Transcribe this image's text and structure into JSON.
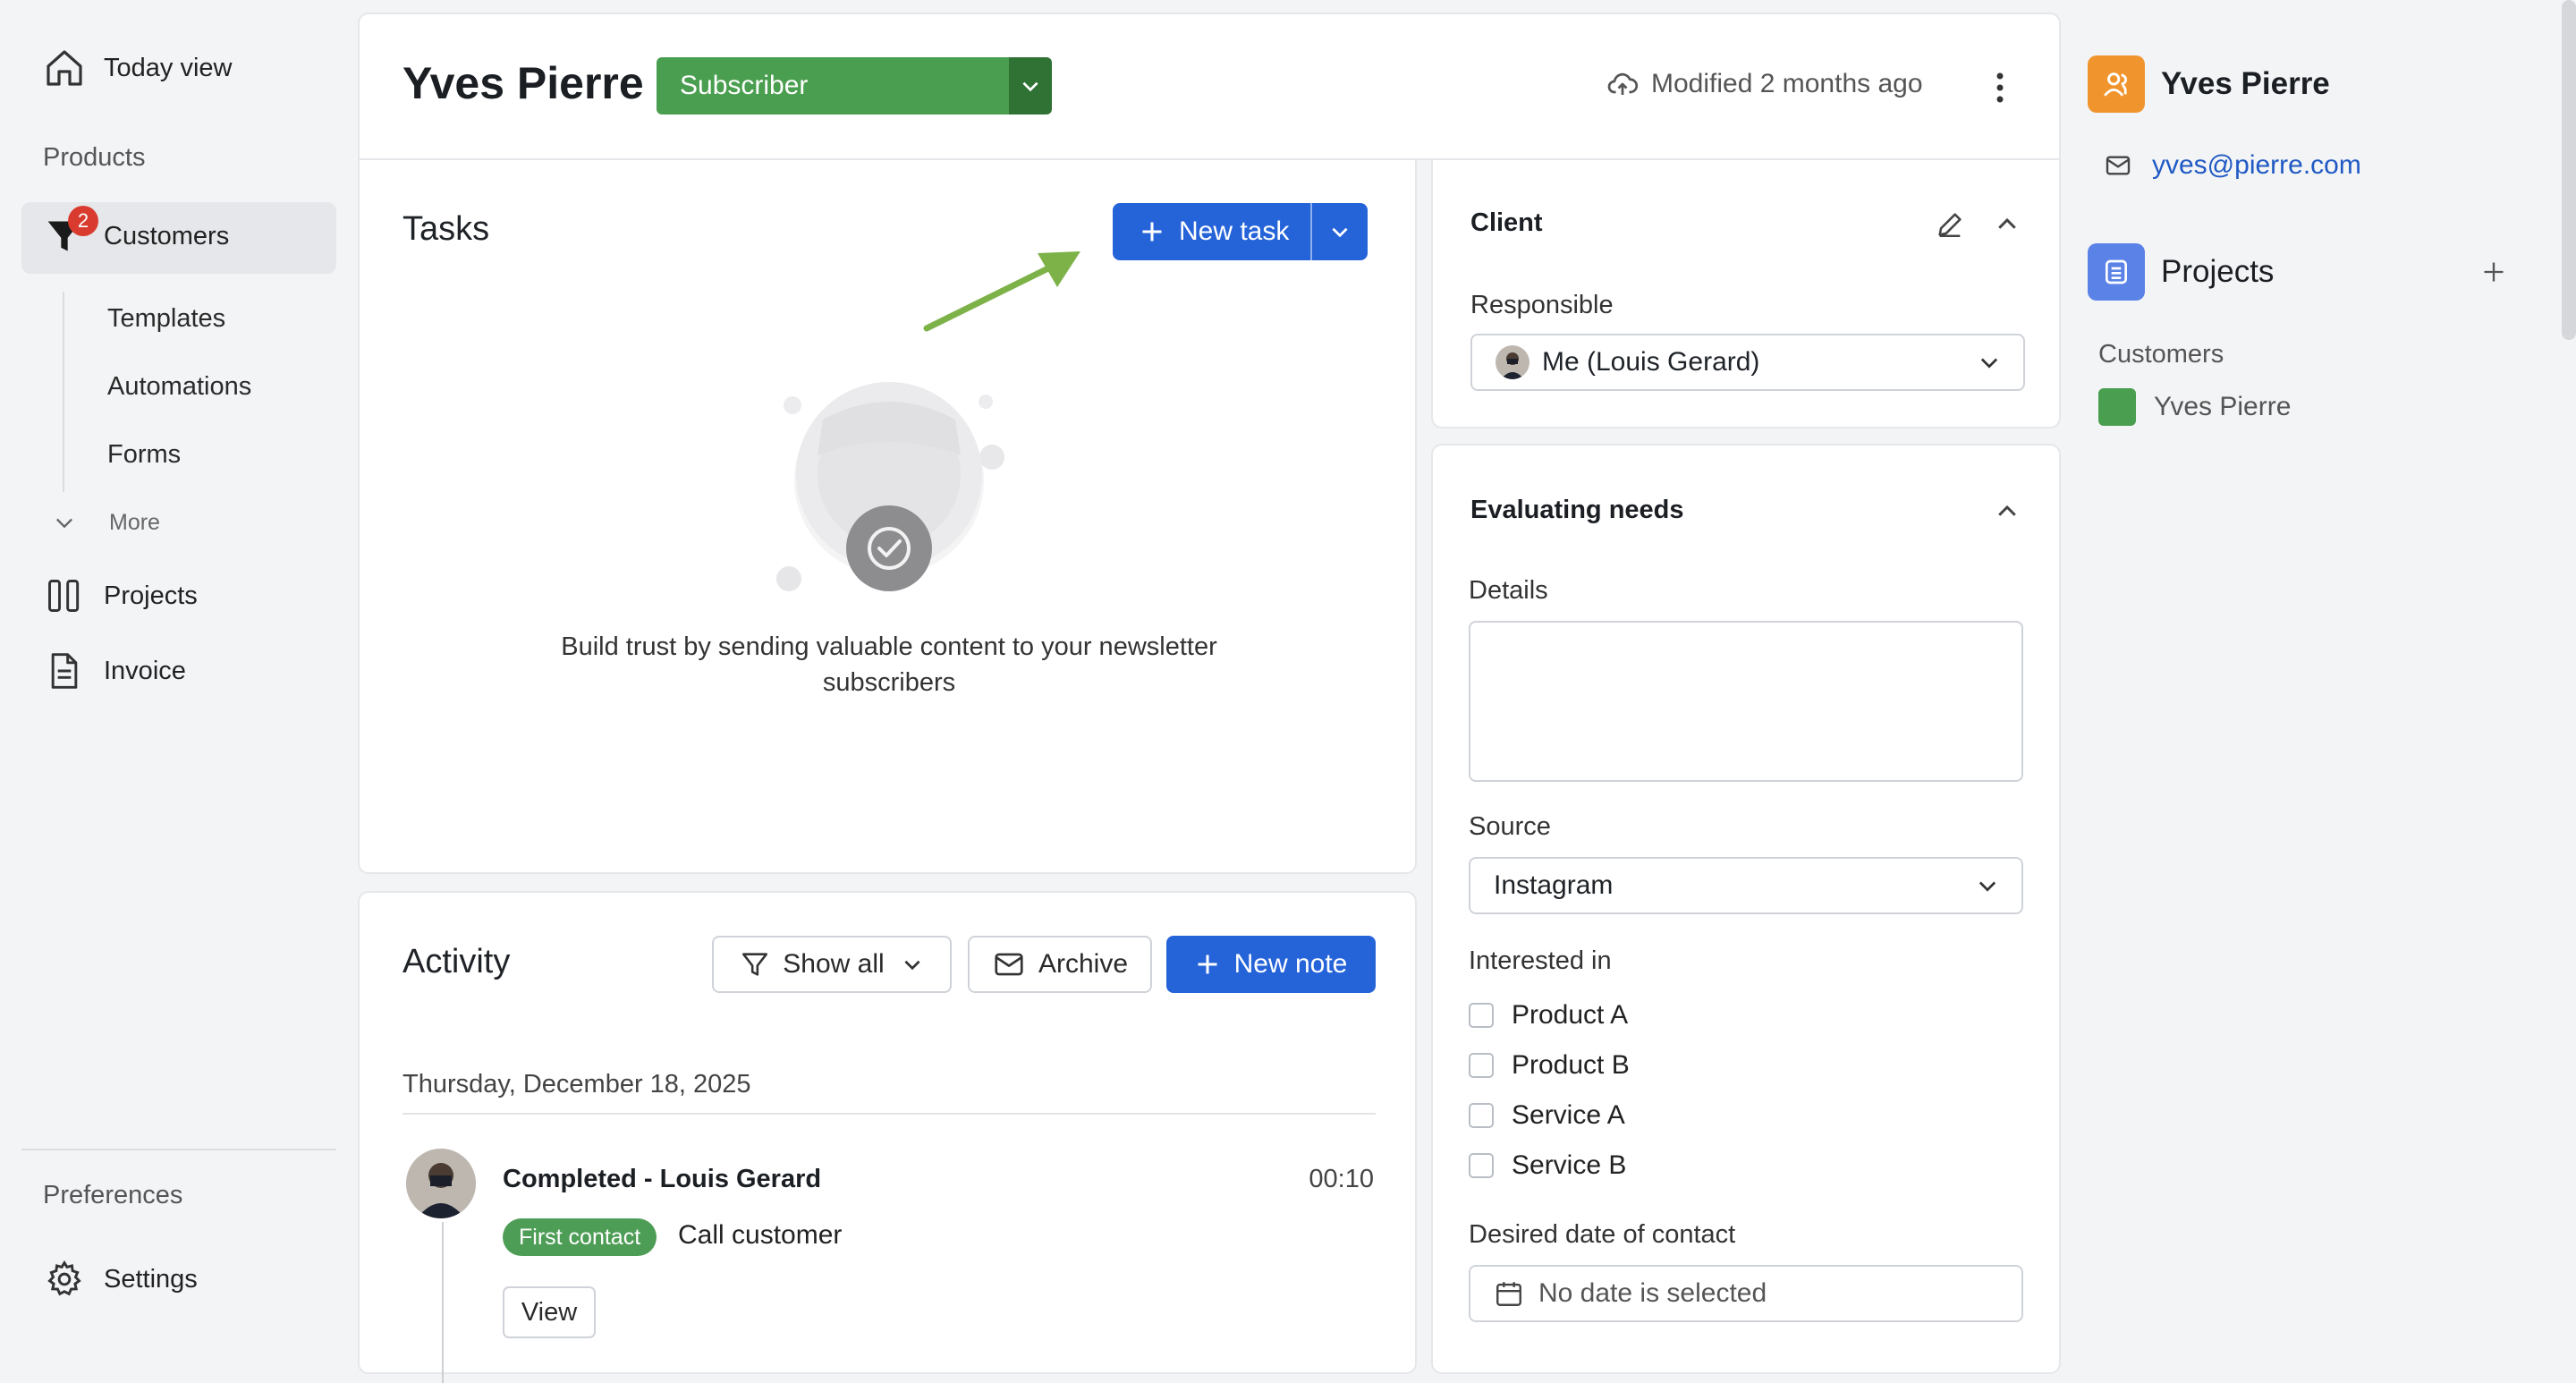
{
  "sidebar": {
    "today_view": "Today view",
    "products_heading": "Products",
    "customers": "Customers",
    "customers_badge": "2",
    "sub_items": [
      "Templates",
      "Automations",
      "Forms"
    ],
    "more": "More",
    "projects": "Projects",
    "invoice": "Invoice",
    "preferences": "Preferences",
    "settings": "Settings"
  },
  "header": {
    "contact_name": "Yves Pierre",
    "stage_label": "Subscriber",
    "modified": "Modified 2 months ago"
  },
  "tasks": {
    "title": "Tasks",
    "new_task": "New task",
    "empty_message": "Build trust by sending valuable content to your newsletter subscribers"
  },
  "activity": {
    "title": "Activity",
    "show_all": "Show all",
    "archive": "Archive",
    "new_note": "New note",
    "date": "Thursday, December 18, 2025",
    "entry": {
      "title": "Completed - Louis Gerard",
      "time": "00:10",
      "tag": "First contact",
      "description": "Call customer",
      "view_button": "View"
    }
  },
  "client_panel": {
    "title": "Client",
    "responsible_label": "Responsible",
    "responsible_value": "Me (Louis Gerard)"
  },
  "needs_panel": {
    "title": "Evaluating needs",
    "details_label": "Details",
    "source_label": "Source",
    "source_value": "Instagram",
    "interested_label": "Interested in",
    "options": [
      "Product A",
      "Product B",
      "Service A",
      "Service B"
    ],
    "date_label": "Desired date of contact",
    "date_placeholder": "No date is selected"
  },
  "right_panel": {
    "name": "Yves Pierre",
    "email": "yves@pierre.com",
    "projects_title": "Projects",
    "customers_label": "Customers",
    "customer_item": "Yves Pierre"
  },
  "colors": {
    "primary": "#2563d9",
    "subscriber_green": "#4a9e4f",
    "tag_green": "#4e9d56",
    "badge_red": "#d93c2e",
    "contact_orange": "#f0952e",
    "projects_blue": "#5b82e6"
  }
}
